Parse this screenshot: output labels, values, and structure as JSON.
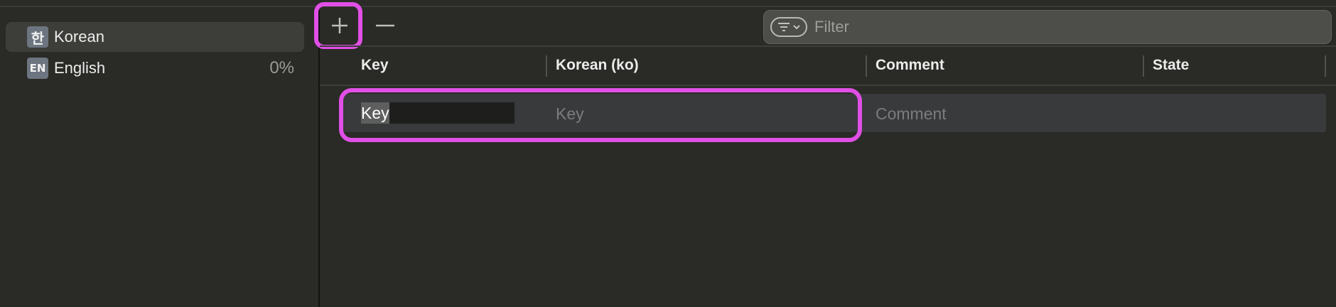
{
  "sidebar": {
    "languages": [
      {
        "badge": "한",
        "label": "Korean",
        "percent": "",
        "selected": true
      },
      {
        "badge": "EN",
        "label": "English",
        "percent": "0%",
        "selected": false
      }
    ]
  },
  "toolbar": {
    "add_icon": "plus-icon",
    "remove_icon": "minus-icon",
    "filter_icon": "filter-lines-icon",
    "filter_placeholder": "Filter"
  },
  "table": {
    "columns": [
      "Key",
      "Korean (ko)",
      "Comment",
      "State"
    ],
    "rows": [
      {
        "key": "Key",
        "korean_placeholder": "Key",
        "comment_placeholder": "Comment",
        "state": ""
      }
    ]
  },
  "colors": {
    "highlight": "#e04fe6",
    "selection": "#3d3d39",
    "background": "#2a2a26"
  }
}
